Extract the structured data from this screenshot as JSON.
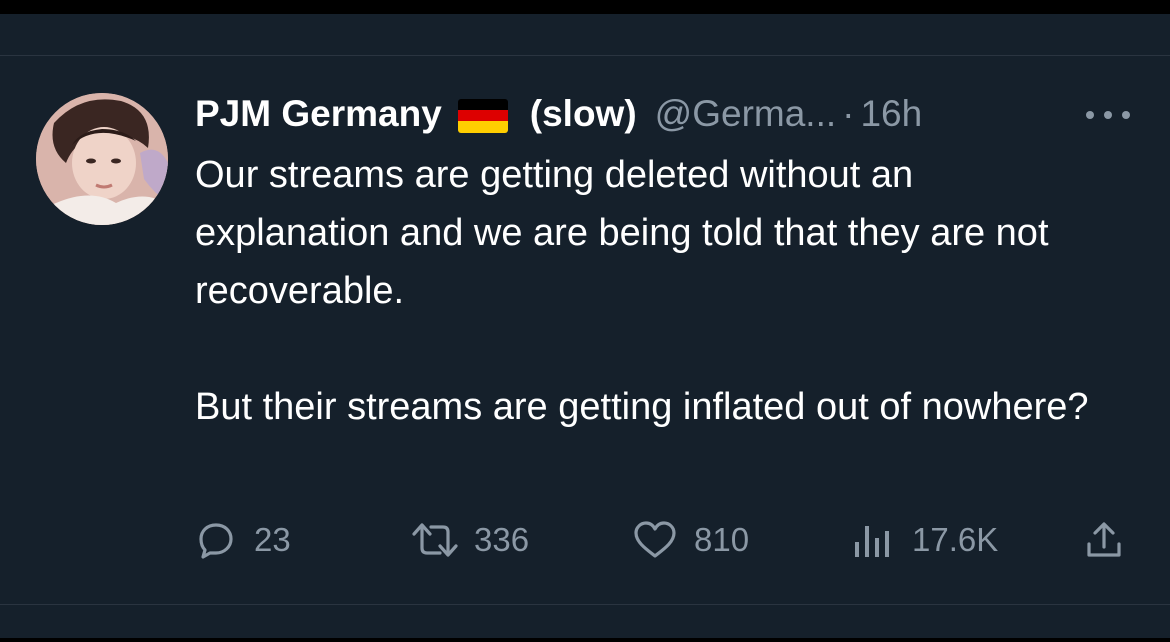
{
  "tweet": {
    "author_name": "PJM Germany",
    "author_suffix": "(slow)",
    "handle": "@Germa...",
    "separator": "·",
    "time": "16h",
    "flag_icon": "germany-flag-icon",
    "paragraphs": [
      "Our streams are getting deleted without an explanation and we are being told that they are not recoverable.",
      "But their streams are getting inflated out of nowhere?"
    ],
    "stats": {
      "replies": "23",
      "retweets": "336",
      "likes": "810",
      "views": "17.6K"
    }
  },
  "icons": {
    "reply": "reply-icon",
    "retweet": "retweet-icon",
    "like": "heart-icon",
    "views": "views-chart-icon",
    "share": "share-icon",
    "more": "more-dots-icon"
  },
  "colors": {
    "background": "#15202b",
    "text_primary": "#ffffff",
    "text_secondary": "#8b98a5",
    "divider": "#2a3440"
  }
}
